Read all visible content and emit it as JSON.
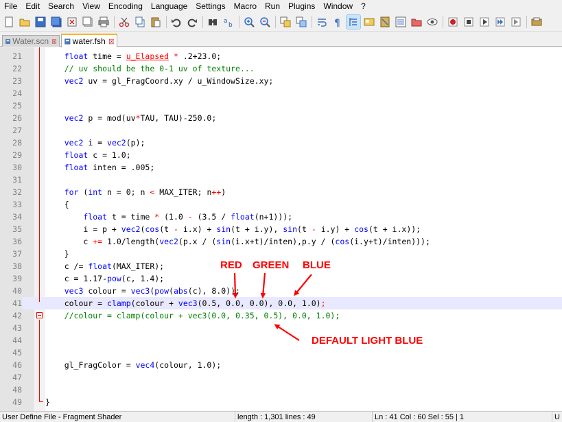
{
  "menu": [
    "File",
    "Edit",
    "Search",
    "View",
    "Encoding",
    "Language",
    "Settings",
    "Macro",
    "Run",
    "Plugins",
    "Window",
    "?"
  ],
  "tabs": [
    {
      "label": "Water.scn",
      "active": false
    },
    {
      "label": "water.fsh",
      "active": true
    }
  ],
  "lines": [
    {
      "n": "21",
      "tokens": [
        [
          "    float",
          "kw"
        ],
        [
          " time = ",
          "p"
        ],
        [
          "u_Elapsed",
          "u"
        ],
        [
          " ",
          "p"
        ],
        [
          "*",
          "op"
        ],
        [
          " .2+23.0;",
          "p"
        ]
      ]
    },
    {
      "n": "22",
      "tokens": [
        [
          "    // uv should be the 0-1 uv of texture...",
          "cm"
        ]
      ]
    },
    {
      "n": "23",
      "tokens": [
        [
          "    vec2",
          "kw"
        ],
        [
          " uv = gl_FragCoord.xy / u_WindowSize.xy;",
          "p"
        ]
      ]
    },
    {
      "n": "24",
      "tokens": []
    },
    {
      "n": "25",
      "tokens": []
    },
    {
      "n": "26",
      "tokens": [
        [
          "    vec2",
          "kw"
        ],
        [
          " p = mod(uv",
          "p"
        ],
        [
          "*",
          "op"
        ],
        [
          "TAU, TAU)-250.0;",
          "p"
        ]
      ]
    },
    {
      "n": "27",
      "tokens": []
    },
    {
      "n": "28",
      "tokens": [
        [
          "    vec2",
          "kw"
        ],
        [
          " i = ",
          "p"
        ],
        [
          "vec2",
          "kw"
        ],
        [
          "(p);",
          "p"
        ]
      ]
    },
    {
      "n": "29",
      "tokens": [
        [
          "    float",
          "kw"
        ],
        [
          " c = 1.0;",
          "p"
        ]
      ]
    },
    {
      "n": "30",
      "tokens": [
        [
          "    float",
          "kw"
        ],
        [
          " inten = .005;",
          "p"
        ]
      ]
    },
    {
      "n": "31",
      "tokens": []
    },
    {
      "n": "32",
      "tokens": [
        [
          "    for",
          "kw"
        ],
        [
          " (",
          "p"
        ],
        [
          "int",
          "kw"
        ],
        [
          " n = 0; n ",
          "p"
        ],
        [
          "<",
          "op"
        ],
        [
          " MAX_ITER; n",
          "p"
        ],
        [
          "++",
          "op"
        ],
        [
          ")",
          "p"
        ]
      ]
    },
    {
      "n": "33",
      "tokens": [
        [
          "    {",
          "p"
        ]
      ]
    },
    {
      "n": "34",
      "tokens": [
        [
          "        float",
          "kw"
        ],
        [
          " t = time ",
          "p"
        ],
        [
          "*",
          "op"
        ],
        [
          " (1.0 ",
          "p"
        ],
        [
          "-",
          "op"
        ],
        [
          " (3.5 / ",
          "p"
        ],
        [
          "float",
          "kw"
        ],
        [
          "(n+1)));",
          "p"
        ]
      ]
    },
    {
      "n": "35",
      "tokens": [
        [
          "        i = p + ",
          "p"
        ],
        [
          "vec2",
          "kw"
        ],
        [
          "(",
          "p"
        ],
        [
          "cos",
          "kw"
        ],
        [
          "(t ",
          "p"
        ],
        [
          "-",
          "op"
        ],
        [
          " i.x) + ",
          "p"
        ],
        [
          "sin",
          "kw"
        ],
        [
          "(t + i.y), ",
          "p"
        ],
        [
          "sin",
          "kw"
        ],
        [
          "(t ",
          "p"
        ],
        [
          "-",
          "op"
        ],
        [
          " i.y) + ",
          "p"
        ],
        [
          "cos",
          "kw"
        ],
        [
          "(t + i.x));",
          "p"
        ]
      ]
    },
    {
      "n": "36",
      "tokens": [
        [
          "        c ",
          "p"
        ],
        [
          "+=",
          "op"
        ],
        [
          " 1.0/length(",
          "p"
        ],
        [
          "vec2",
          "kw"
        ],
        [
          "(p.x / (",
          "p"
        ],
        [
          "sin",
          "kw"
        ],
        [
          "(i.x+t)/inten),p.y / (",
          "p"
        ],
        [
          "cos",
          "kw"
        ],
        [
          "(i.y+t)/inten)));",
          "p"
        ]
      ]
    },
    {
      "n": "37",
      "tokens": [
        [
          "    }",
          "p"
        ]
      ]
    },
    {
      "n": "38",
      "tokens": [
        [
          "    c /= ",
          "p"
        ],
        [
          "float",
          "kw"
        ],
        [
          "(MAX_ITER);",
          "p"
        ]
      ]
    },
    {
      "n": "39",
      "tokens": [
        [
          "    c = 1.17-",
          "p"
        ],
        [
          "pow",
          "kw"
        ],
        [
          "(c, 1.4);",
          "p"
        ]
      ]
    },
    {
      "n": "40",
      "tokens": [
        [
          "    vec3",
          "kw"
        ],
        [
          " colour = ",
          "p"
        ],
        [
          "vec3",
          "kw"
        ],
        [
          "(",
          "p"
        ],
        [
          "pow",
          "kw"
        ],
        [
          "(",
          "p"
        ],
        [
          "abs",
          "kw"
        ],
        [
          "(c), 8.0));",
          "p"
        ]
      ]
    },
    {
      "n": "41",
      "tokens": [
        [
          "    colour = ",
          "p"
        ],
        [
          "clamp",
          "kw"
        ],
        [
          "(colour + ",
          "p"
        ],
        [
          "vec3",
          "kw"
        ],
        [
          "(0.5, 0.0, 0.0), 0.0, 1.0)",
          "p"
        ],
        [
          ";",
          "op"
        ]
      ]
    },
    {
      "n": "42",
      "tokens": [
        [
          "    //colour = clamp(colour + vec3(0.0, 0.35, 0.5), 0.0, 1.0);",
          "cm"
        ]
      ]
    },
    {
      "n": "43",
      "tokens": []
    },
    {
      "n": "44",
      "tokens": []
    },
    {
      "n": "45",
      "tokens": []
    },
    {
      "n": "46",
      "tokens": [
        [
          "    gl_FragColor = ",
          "p"
        ],
        [
          "vec4",
          "kw"
        ],
        [
          "(colour, 1.0);",
          "p"
        ]
      ]
    },
    {
      "n": "47",
      "tokens": []
    },
    {
      "n": "48",
      "tokens": []
    },
    {
      "n": "49",
      "tokens": [
        [
          "}",
          "p"
        ]
      ]
    }
  ],
  "annotations": {
    "red": "RED",
    "green": "GREEN",
    "blue": "BLUE",
    "default": "DEFAULT LIGHT BLUE"
  },
  "status": {
    "language": "User Define File - Fragment Shader",
    "length": "length : 1,301    lines : 49",
    "position": "Ln : 41    Col : 60    Sel : 55 | 1",
    "extra": "U"
  },
  "colors": {
    "keyword": "#0000ff",
    "uniform": "#ff0000",
    "operator": "#ff0000",
    "comment": "#008000",
    "annotation": "#ff0000",
    "current_line": "#e8e8ff"
  }
}
